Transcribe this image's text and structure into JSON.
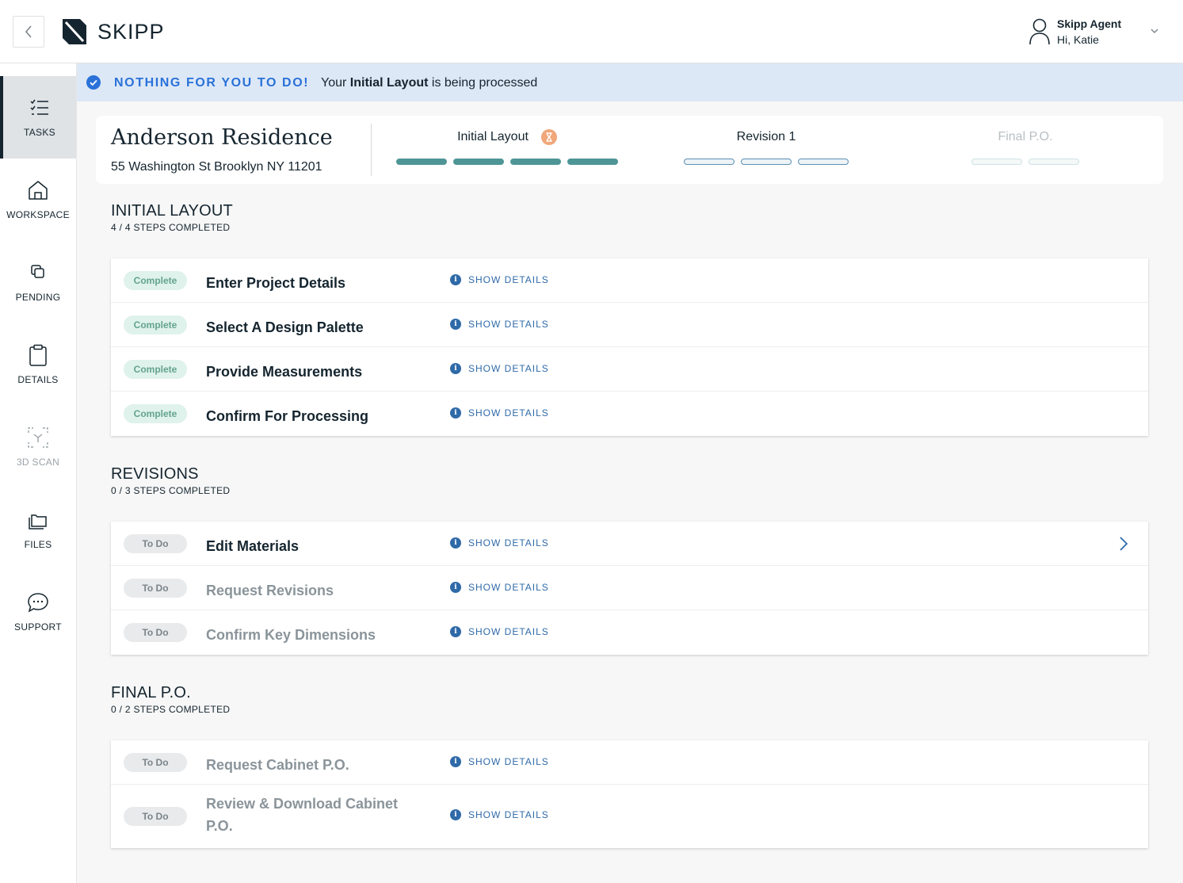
{
  "app": {
    "brand": "SKIPP"
  },
  "user": {
    "name": "Skipp Agent",
    "greeting": "Hi, Katie"
  },
  "sidebar": {
    "items": [
      {
        "label": "TASKS",
        "icon": "tasks-list-icon",
        "active": true
      },
      {
        "label": "WORKSPACE",
        "icon": "home-icon"
      },
      {
        "label": "PENDING",
        "icon": "copy-icon"
      },
      {
        "label": "DETAILS",
        "icon": "clipboard-icon"
      },
      {
        "label": "3D SCAN",
        "icon": "scan-icon",
        "disabled": true
      },
      {
        "label": "FILES",
        "icon": "folder-icon"
      },
      {
        "label": "SUPPORT",
        "icon": "chat-icon"
      }
    ]
  },
  "banner": {
    "title": "NOTHING FOR YOU TO DO!",
    "msg_prefix": "Your",
    "msg_bold": "Initial Layout",
    "msg_suffix": "is being processed"
  },
  "project": {
    "name": "Anderson Residence",
    "address": "55 Washington St Brooklyn NY 11201",
    "stages": [
      {
        "label": "Initial Layout",
        "status": "processing",
        "bars_total": 4,
        "bars_done": 4
      },
      {
        "label": "Revision 1",
        "status": "open",
        "bars_total": 3,
        "bars_done": 0
      },
      {
        "label": "Final P.O.",
        "status": "disabled",
        "bars_total": 2,
        "bars_done": 0
      }
    ]
  },
  "details_label": "SHOW DETAILS",
  "sections": [
    {
      "title": "INITIAL LAYOUT",
      "subtitle": "4 / 4 STEPS COMPLETED",
      "tasks": [
        {
          "status": "Complete",
          "name": "Enter Project Details"
        },
        {
          "status": "Complete",
          "name": "Select A Design Palette"
        },
        {
          "status": "Complete",
          "name": "Provide Measurements"
        },
        {
          "status": "Complete",
          "name": "Confirm For Processing"
        }
      ]
    },
    {
      "title": "REVISIONS",
      "subtitle": "0 / 3 STEPS COMPLETED",
      "tasks": [
        {
          "status": "To Do",
          "name": "Edit Materials"
        },
        {
          "status": "To Do",
          "name": "Request Revisions"
        },
        {
          "status": "To Do",
          "name": "Confirm Key Dimensions"
        }
      ]
    },
    {
      "title": "FINAL P.O.",
      "subtitle": "0 / 2 STEPS COMPLETED",
      "tasks": [
        {
          "status": "To Do",
          "name": "Request Cabinet P.O."
        },
        {
          "status": "To Do",
          "name": "Review & Download Cabinet P.O."
        }
      ]
    }
  ],
  "colors": {
    "accent_blue": "#2a72d8",
    "progress_done": "#4e9596",
    "complete_pill": "#dff2ec",
    "banner_bg": "#dde8f7"
  }
}
